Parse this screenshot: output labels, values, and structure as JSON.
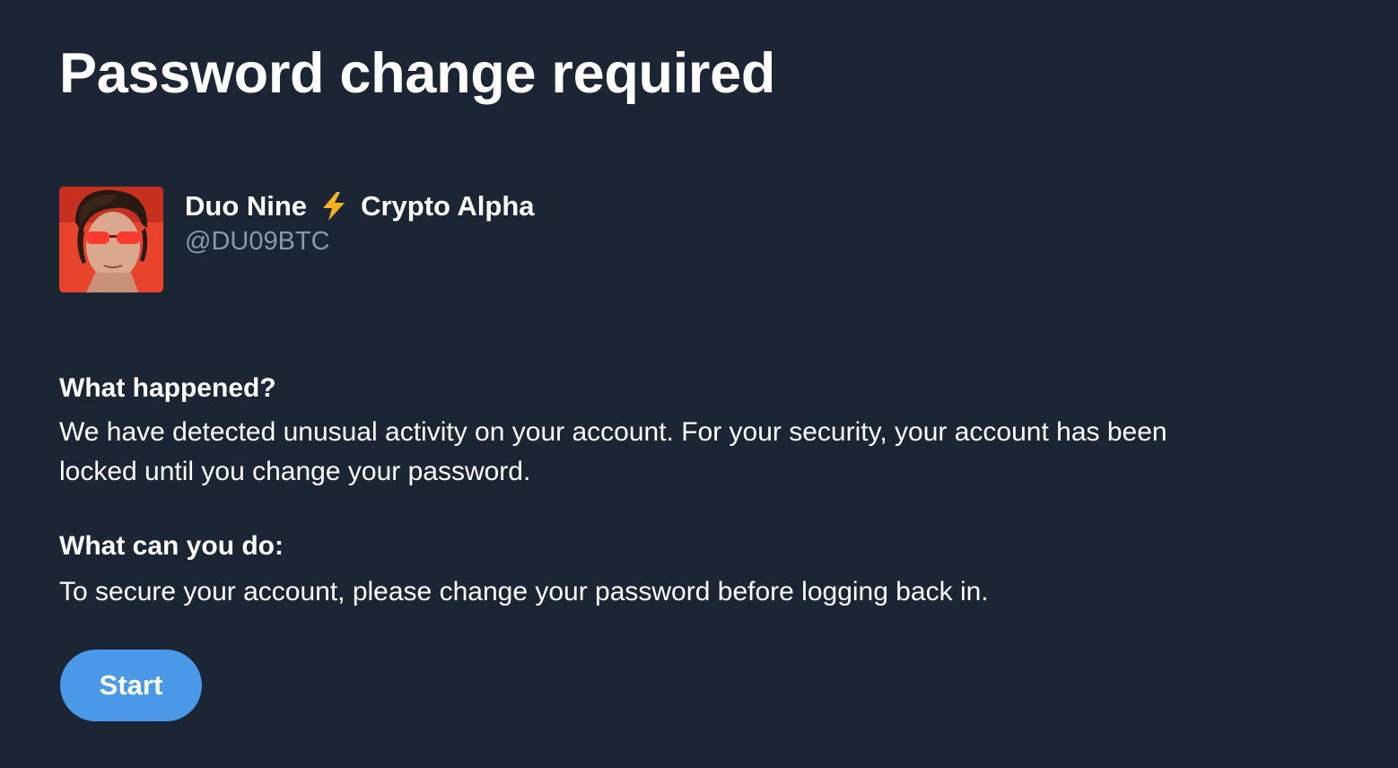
{
  "page": {
    "title": "Password change required",
    "background": "#1c2533"
  },
  "profile": {
    "display_name_part1": "Duo Nine",
    "name_icon": "lightning-bolt-icon",
    "display_name_part2": "Crypto Alpha",
    "handle": "@DU09BTC",
    "avatar_colors": {
      "background": "#e8432c",
      "accent": "#ff3b2f"
    }
  },
  "sections": {
    "what_happened": {
      "heading": "What happened?",
      "body_line1": "We have detected unusual activity on your account. For your security, your account has been",
      "body_line2": "locked until you change your password."
    },
    "what_can_you_do": {
      "heading": "What can you do:",
      "body": "To secure your account, please change your password before logging back in."
    }
  },
  "actions": {
    "start_label": "Start",
    "button_color": "#4a99e9"
  }
}
